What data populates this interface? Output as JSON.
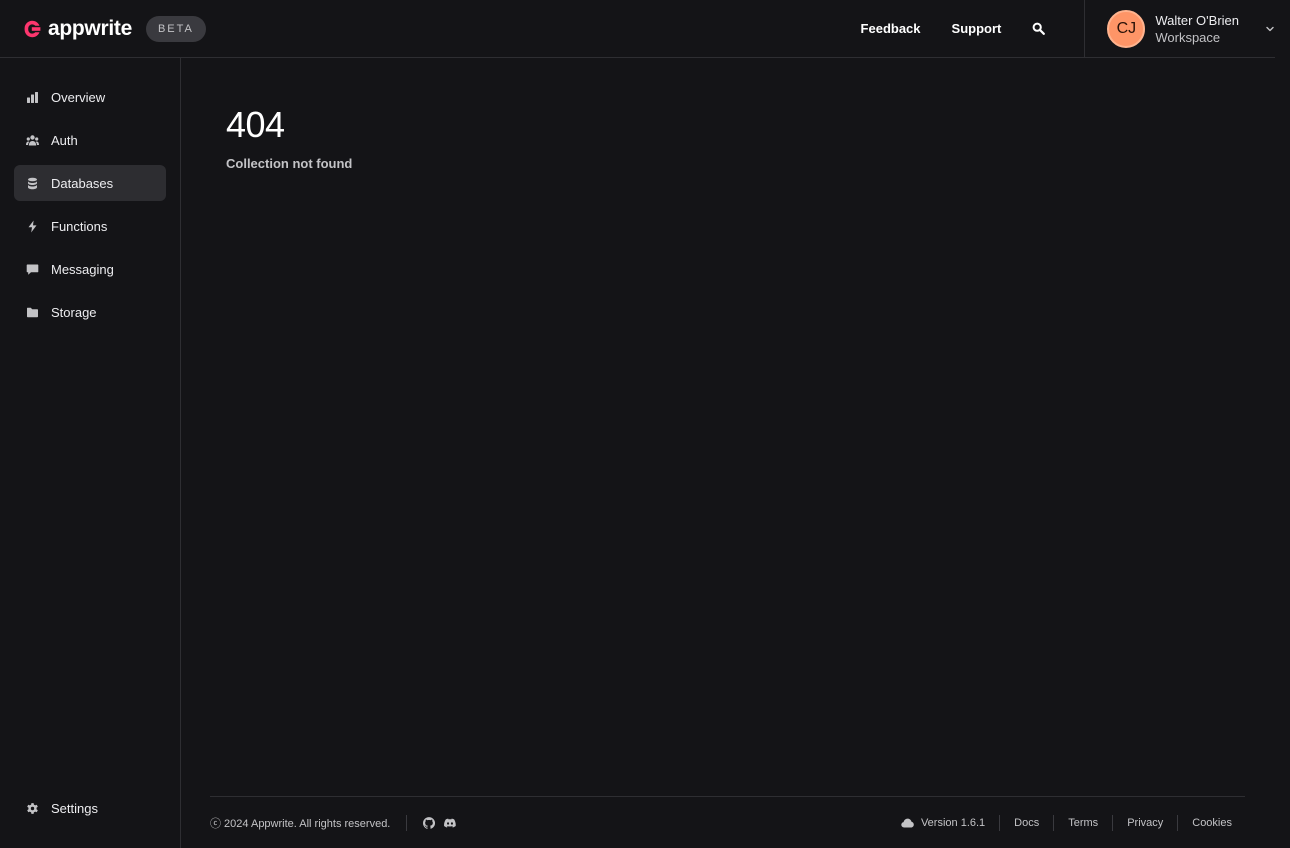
{
  "header": {
    "brand": "appwrite",
    "badge": "BETA",
    "feedback_label": "Feedback",
    "support_label": "Support",
    "account": {
      "initials": "CJ",
      "name": "Walter O'Brien",
      "organization": "Workspace"
    }
  },
  "sidebar": {
    "items": [
      {
        "label": "Overview",
        "icon": "chart-bar-icon"
      },
      {
        "label": "Auth",
        "icon": "users-icon"
      },
      {
        "label": "Databases",
        "icon": "database-icon",
        "active": true
      },
      {
        "label": "Functions",
        "icon": "lightning-icon"
      },
      {
        "label": "Messaging",
        "icon": "chat-icon"
      },
      {
        "label": "Storage",
        "icon": "folder-icon"
      }
    ],
    "settings_label": "Settings"
  },
  "main": {
    "error_code": "404",
    "error_message": "Collection not found"
  },
  "footer": {
    "copyright": "ⓒ 2024 Appwrite. All rights reserved.",
    "version": "Version 1.6.1",
    "links": [
      "Docs",
      "Terms",
      "Privacy",
      "Cookies"
    ]
  },
  "colors": {
    "background": "#141417",
    "brand_pink": "#fd366e",
    "avatar": "#fe9567",
    "active_item": "#2d2d31"
  }
}
